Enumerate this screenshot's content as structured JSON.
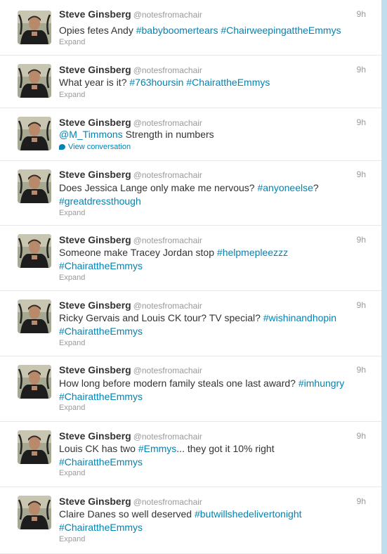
{
  "author": {
    "name": "Steve Ginsberg",
    "handle": "@notesfromachair"
  },
  "colors": {
    "link": "#0084b4",
    "muted": "#999999",
    "text": "#333333",
    "background": "#c0deed"
  },
  "tweets": [
    {
      "time": "9h",
      "parts": [
        {
          "t": "Opies fetes Andy "
        },
        {
          "t": "#babyboomertears",
          "link": true
        },
        {
          "t": " "
        },
        {
          "t": "#ChairweepingattheEmmys",
          "link": true
        }
      ],
      "action": "Expand"
    },
    {
      "time": "9h",
      "parts": [
        {
          "t": "What year is it? "
        },
        {
          "t": "#763hoursin",
          "link": true
        },
        {
          "t": " "
        },
        {
          "t": "#ChairattheEmmys",
          "link": true
        }
      ],
      "action": "Expand"
    },
    {
      "time": "9h",
      "parts": [
        {
          "t": "@M_Timmons",
          "link": true
        },
        {
          "t": " Strength in numbers"
        }
      ],
      "action": "View conversation",
      "conversation": true
    },
    {
      "time": "9h",
      "parts": [
        {
          "t": "Does Jessica Lange only make me nervous? "
        },
        {
          "t": "#anyoneelse",
          "link": true
        },
        {
          "t": "?"
        },
        {
          "br": true
        },
        {
          "t": "#greatdressthough",
          "link": true
        }
      ],
      "action": "Expand"
    },
    {
      "time": "9h",
      "parts": [
        {
          "t": "Someone make Tracey Jordan stop "
        },
        {
          "t": "#helpmepleezzz",
          "link": true
        },
        {
          "br": true
        },
        {
          "t": "#ChairattheEmmys",
          "link": true
        }
      ],
      "action": "Expand"
    },
    {
      "time": "9h",
      "parts": [
        {
          "t": "Ricky Gervais and Louis CK tour? TV special? "
        },
        {
          "t": "#wishinandhopin",
          "link": true
        },
        {
          "br": true
        },
        {
          "t": "#ChairattheEmmys",
          "link": true
        }
      ],
      "action": "Expand"
    },
    {
      "time": "9h",
      "parts": [
        {
          "t": "How long before modern family steals one last award? "
        },
        {
          "t": "#imhungry",
          "link": true
        },
        {
          "br": true
        },
        {
          "t": "#ChairattheEmmys",
          "link": true
        }
      ],
      "action": "Expand"
    },
    {
      "time": "9h",
      "parts": [
        {
          "t": "Louis CK has two "
        },
        {
          "t": "#Emmys",
          "link": true
        },
        {
          "t": "... they got it 10% right"
        },
        {
          "br": true
        },
        {
          "t": "#ChairattheEmmys",
          "link": true
        }
      ],
      "action": "Expand"
    },
    {
      "time": "9h",
      "parts": [
        {
          "t": "Claire Danes so well deserved "
        },
        {
          "t": "#butwillshedelivertonight",
          "link": true
        },
        {
          "br": true
        },
        {
          "t": "#ChairattheEmmys",
          "link": true
        }
      ],
      "action": "Expand"
    }
  ]
}
